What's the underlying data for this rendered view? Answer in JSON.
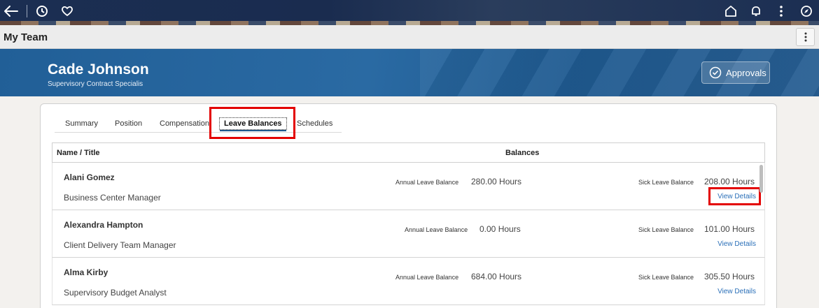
{
  "page_title": "My Team",
  "employee": {
    "name": "Cade Johnson",
    "role": "Supervisory Contract Specialis"
  },
  "approvals_label": "Approvals",
  "tabs": [
    {
      "label": "Summary"
    },
    {
      "label": "Position"
    },
    {
      "label": "Compensation"
    },
    {
      "label": "Leave Balances",
      "active": true
    },
    {
      "label": "Schedules"
    }
  ],
  "grid": {
    "headers": {
      "name_title": "Name / Title",
      "balances": "Balances"
    },
    "rows": [
      {
        "name": "Alani Gomez",
        "title": "Business Center Manager",
        "annual_label": "Annual Leave Balance",
        "annual_value": "280.00 Hours",
        "sick_label": "Sick Leave Balance",
        "sick_value": "208.00 Hours",
        "link": "View Details"
      },
      {
        "name": "Alexandra Hampton",
        "title": "Client Delivery Team Manager",
        "annual_label": "Annual Leave Balance",
        "annual_value": "0.00 Hours",
        "sick_label": "Sick Leave Balance",
        "sick_value": "101.00 Hours",
        "link": "View Details"
      },
      {
        "name": "Alma Kirby",
        "title": "Supervisory Budget Analyst",
        "annual_label": "Annual Leave Balance",
        "annual_value": "684.00 Hours",
        "sick_label": "Sick Leave Balance",
        "sick_value": "305.50 Hours",
        "link": "View Details"
      }
    ]
  },
  "icons": {
    "back": "arrow-left-icon",
    "recent": "clock-icon",
    "favorites": "heart-icon",
    "home": "home-icon",
    "notifications": "bell-icon",
    "actions": "kebab-icon",
    "navigator": "compass-icon",
    "approvals": "check-circle-icon"
  },
  "colors": {
    "nav_bg": "#1b2e52",
    "banner_bg": "#215f97",
    "link": "#2a6fb8",
    "highlight": "#e30000"
  }
}
